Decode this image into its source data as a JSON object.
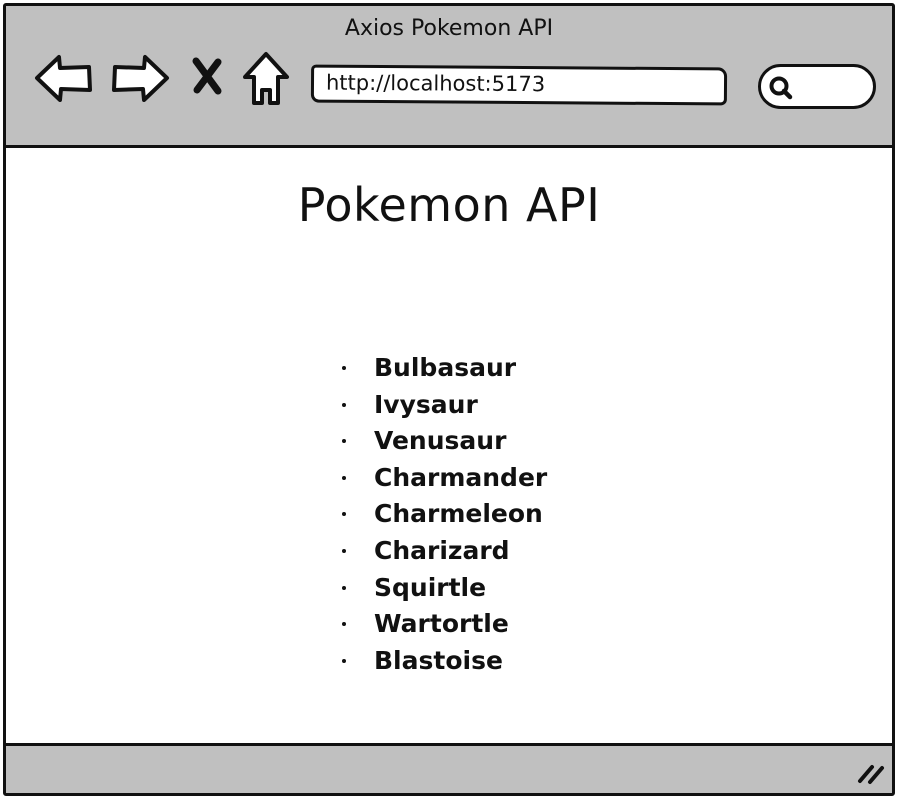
{
  "window": {
    "title": "Axios Pokemon API"
  },
  "toolbar": {
    "back_icon": "arrow-left",
    "forward_icon": "arrow-right",
    "stop_icon": "x-mark",
    "home_icon": "house",
    "search_icon": "magnifier"
  },
  "address_bar": {
    "url": "http://localhost:5173"
  },
  "page": {
    "heading": "Pokemon API",
    "pokemon": [
      "Bulbasaur",
      "Ivysaur",
      "Venusaur",
      "Charmander",
      "Charmeleon",
      "Charizard",
      "Squirtle",
      "Wartortle",
      "Blastoise"
    ]
  },
  "colors": {
    "chrome": "#c0c0c0",
    "ink": "#111111",
    "background": "#ffffff"
  }
}
